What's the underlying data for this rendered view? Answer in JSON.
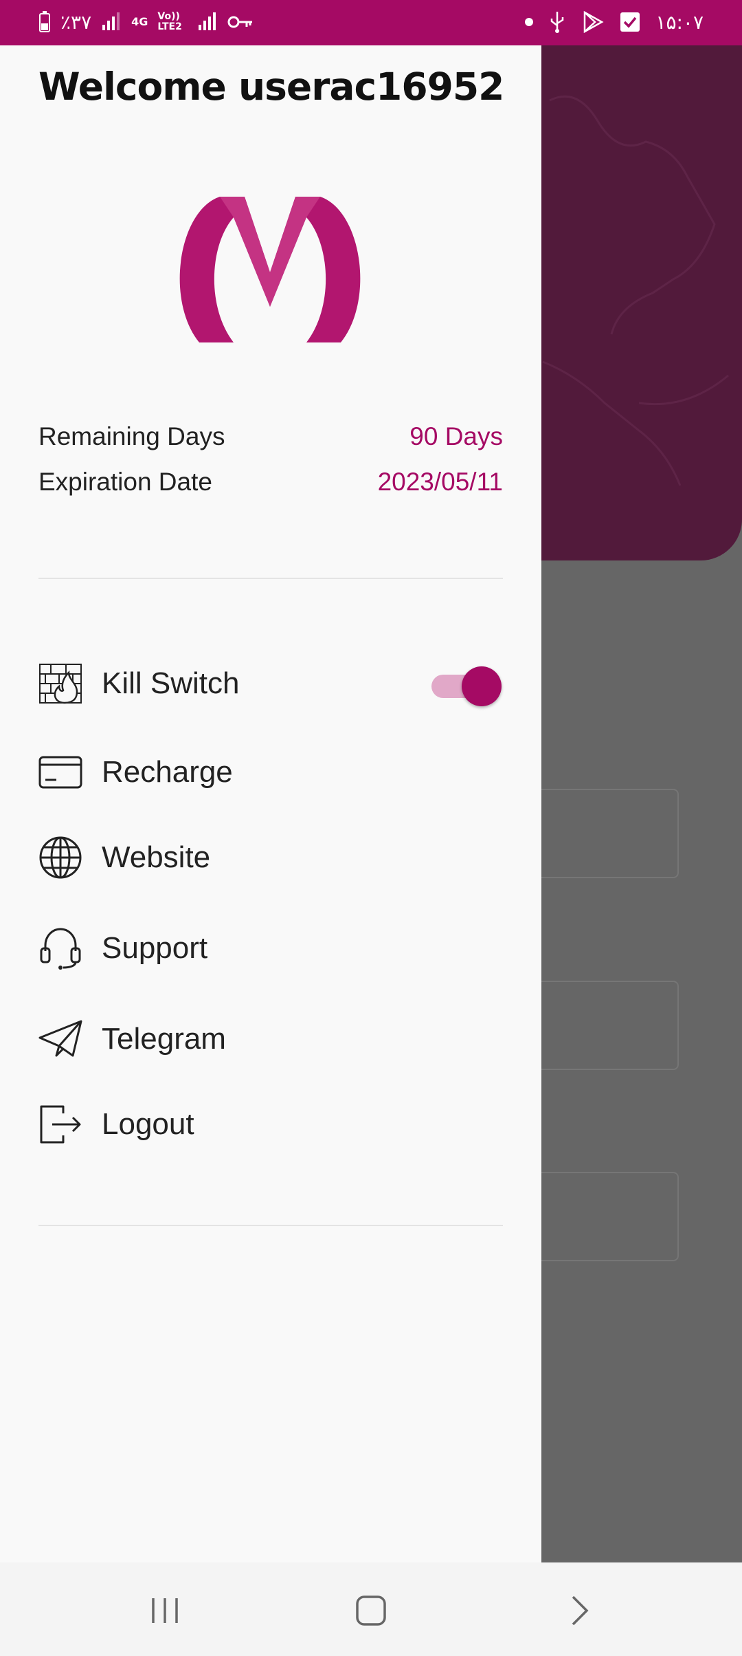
{
  "status_bar": {
    "battery": "٪۳۷",
    "network": "4G",
    "volte": "Vo)) LTE2",
    "time": "۱۵:۰۷"
  },
  "drawer": {
    "welcome": "Welcome userac16952",
    "remaining_label": "Remaining Days",
    "remaining_value": "90 Days",
    "expiration_label": "Expiration Date",
    "expiration_value": "2023/05/11",
    "kill_switch": {
      "label": "Kill Switch",
      "enabled": true
    },
    "menu": [
      {
        "label": "Recharge",
        "icon": "credit-card-icon"
      },
      {
        "label": "Website",
        "icon": "globe-icon"
      },
      {
        "label": "Support",
        "icon": "headset-icon"
      },
      {
        "label": "Telegram",
        "icon": "paper-plane-icon"
      },
      {
        "label": "Logout",
        "icon": "logout-icon"
      }
    ]
  },
  "colors": {
    "accent": "#a50a64",
    "status_bar": "#a50a64",
    "scrim": "#666666"
  },
  "nav_bar": {
    "buttons": [
      "recent-apps",
      "home",
      "back"
    ]
  }
}
